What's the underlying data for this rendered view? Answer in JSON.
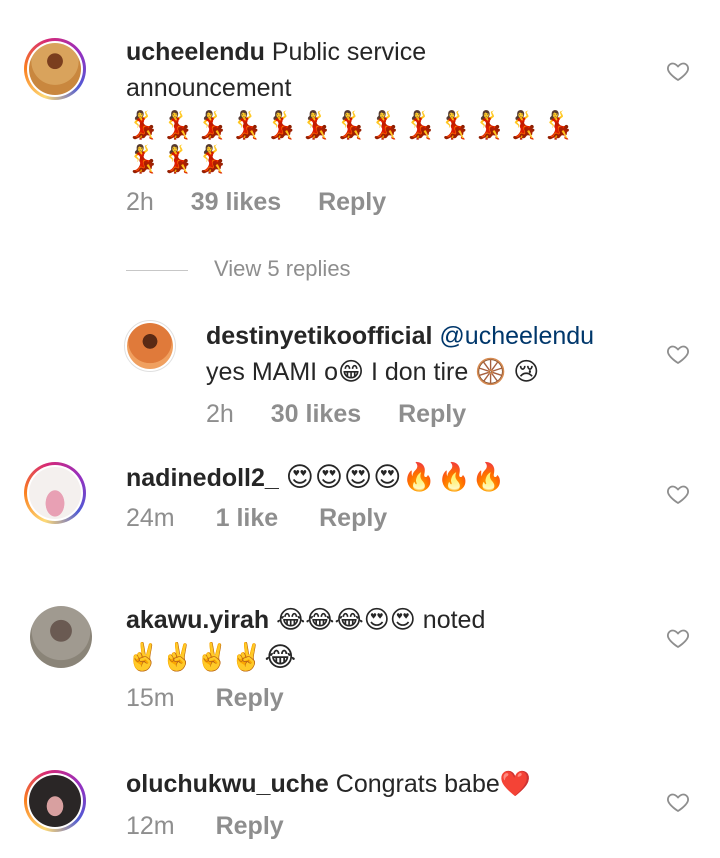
{
  "comments": [
    {
      "username": "ucheelendu",
      "text_line1": "Public service",
      "text_line2": "announcement",
      "emoji_line1": "💃💃💃💃💃💃💃💃💃💃💃💃💃",
      "emoji_line2": "💃💃💃",
      "time": "2h",
      "likes": "39 likes",
      "reply": "Reply",
      "view_replies": "View 5 replies"
    },
    {
      "username": "destinyetikoofficial",
      "mention": "@ucheelendu",
      "text": "yes MAMI o😁 I don tire 🛞 😢",
      "time": "2h",
      "likes": "30 likes",
      "reply": "Reply"
    },
    {
      "username": "nadinedoll2_",
      "text": "😍😍😍😍🔥🔥🔥",
      "time": "24m",
      "likes": "1 like",
      "reply": "Reply"
    },
    {
      "username": "akawu.yirah",
      "text": "😂😂😂😍😍 noted",
      "emoji_line": "✌️✌️✌️✌️😂",
      "time": "15m",
      "reply": "Reply"
    },
    {
      "username": "oluchukwu_uche",
      "text": "Congrats babe❤️",
      "time": "12m",
      "reply": "Reply"
    }
  ],
  "colors": {
    "text": "#262626",
    "meta": "#8e8e8e",
    "mention": "#00376b",
    "heart_outline": "#8e8e8e"
  },
  "icons": {
    "like": "heart-outline-icon"
  }
}
